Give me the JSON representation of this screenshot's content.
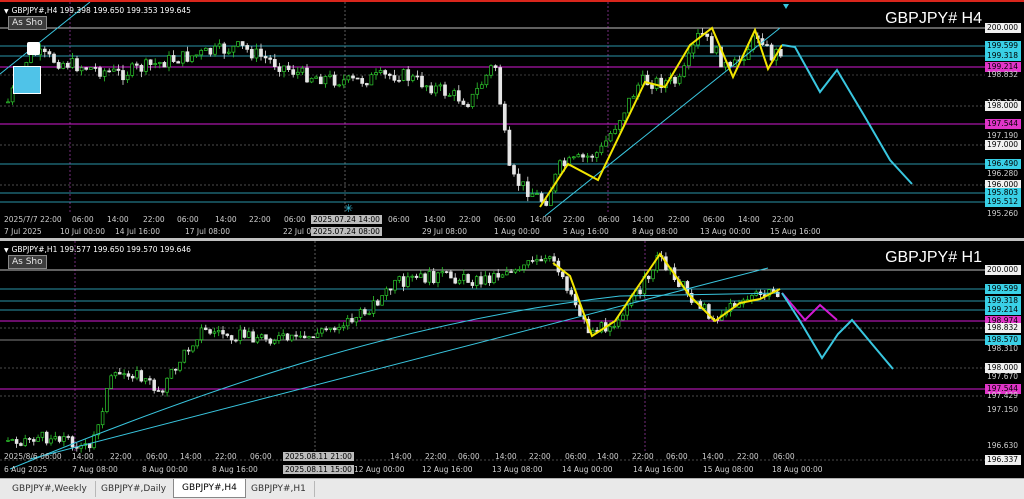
{
  "colors": {
    "up": "#2ecc2e",
    "down": "#e6e6e6",
    "trend": "#39c6df",
    "zigzag": "#f2e600",
    "magenta": "#d21ad2",
    "cyan_box": "#39d0e6",
    "pink_box": "#e035c8",
    "grid": "#ffffff"
  },
  "h4": {
    "symbol_info": "GBPJPY#,H4  199.398 199.650 199.353 199.645",
    "button": "As Sho",
    "title": "GBPJPY# H4",
    "price_labels": [
      {
        "text": "200.000",
        "style": "white"
      },
      {
        "text": "199.599",
        "style": "cyan"
      },
      {
        "text": "199.318",
        "style": "cyan"
      },
      {
        "text": "199.214",
        "style": "pink"
      },
      {
        "text": "198.832",
        "style": "plain"
      },
      {
        "text": "198.110",
        "style": "plain"
      },
      {
        "text": "198.000",
        "style": "white"
      },
      {
        "text": "197.544",
        "style": "pink"
      },
      {
        "text": "197.190",
        "style": "plain"
      },
      {
        "text": "197.000",
        "style": "white"
      },
      {
        "text": "196.490",
        "style": "cyan"
      },
      {
        "text": "196.280",
        "style": "plain"
      },
      {
        "text": "196.000",
        "style": "white"
      },
      {
        "text": "195.803",
        "style": "cyan"
      },
      {
        "text": "195.512",
        "style": "cyan"
      },
      {
        "text": "195.260",
        "style": "plain"
      }
    ],
    "time_labels": [
      "2025/7/7 22:00",
      "06:00",
      "14:00",
      "22:00",
      "06:00",
      "14:00",
      "22:00",
      "06:00",
      "2025.07.24 14:00",
      "06:00",
      "14:00",
      "22:00",
      "06:00",
      "14:00",
      "22:00",
      "06:00",
      "14:00",
      "22:00",
      "06:00",
      "14:00",
      "22:00"
    ],
    "time_labels_bottom": [
      "7 Jul 2025",
      "10 Jul 00:00",
      "14 Jul 16:00",
      "17 Jul 08:00",
      "22 Jul 00:00",
      "2025.07.24 08:00",
      "29 Jul 08:00",
      "1 Aug 00:00",
      "5 Aug 16:00",
      "8 Aug 08:00",
      "13 Aug 00:00",
      "15 Aug 16:00"
    ]
  },
  "h1": {
    "symbol_info": "GBPJPY#,H1  199.577 199.650 199.570 199.646",
    "button": "As Sho",
    "title": "GBPJPY# H1",
    "price_labels": [
      {
        "text": "200.000",
        "style": "white"
      },
      {
        "text": "199.599",
        "style": "cyan"
      },
      {
        "text": "199.318",
        "style": "cyan"
      },
      {
        "text": "199.214",
        "style": "cyan"
      },
      {
        "text": "198.974",
        "style": "pink"
      },
      {
        "text": "198.832",
        "style": "white"
      },
      {
        "text": "198.570",
        "style": "cyan"
      },
      {
        "text": "198.310",
        "style": "plain"
      },
      {
        "text": "198.000",
        "style": "white"
      },
      {
        "text": "197.670",
        "style": "plain"
      },
      {
        "text": "197.544",
        "style": "pink"
      },
      {
        "text": "197.429",
        "style": "plain"
      },
      {
        "text": "197.150",
        "style": "plain"
      },
      {
        "text": "196.630",
        "style": "plain"
      },
      {
        "text": "196.337",
        "style": "white"
      }
    ],
    "time_labels": [
      "2025/8/6 06:00",
      "14:00",
      "22:00",
      "06:00",
      "14:00",
      "22:00",
      "06:00",
      "2025.08.11 21:00",
      "14:00",
      "22:00",
      "06:00",
      "14:00",
      "22:00",
      "06:00",
      "14:00",
      "22:00",
      "06:00",
      "14:00",
      "22:00",
      "06:00"
    ],
    "time_labels_bottom": [
      "6 Aug 2025",
      "7 Aug 08:00",
      "8 Aug 00:00",
      "8 Aug 16:00",
      "2025.08.11 15:00",
      "12 Aug 00:00",
      "12 Aug 16:00",
      "13 Aug 08:00",
      "14 Aug 00:00",
      "14 Aug 16:00",
      "15 Aug 08:00",
      "18 Aug 00:00"
    ]
  },
  "tabs": [
    {
      "label": "GBPJPY#,Weekly"
    },
    {
      "label": "GBPJPY#,Daily"
    },
    {
      "label": "GBPJPY#,H4",
      "active": true
    },
    {
      "label": "GBPJPY#,H1"
    }
  ]
}
